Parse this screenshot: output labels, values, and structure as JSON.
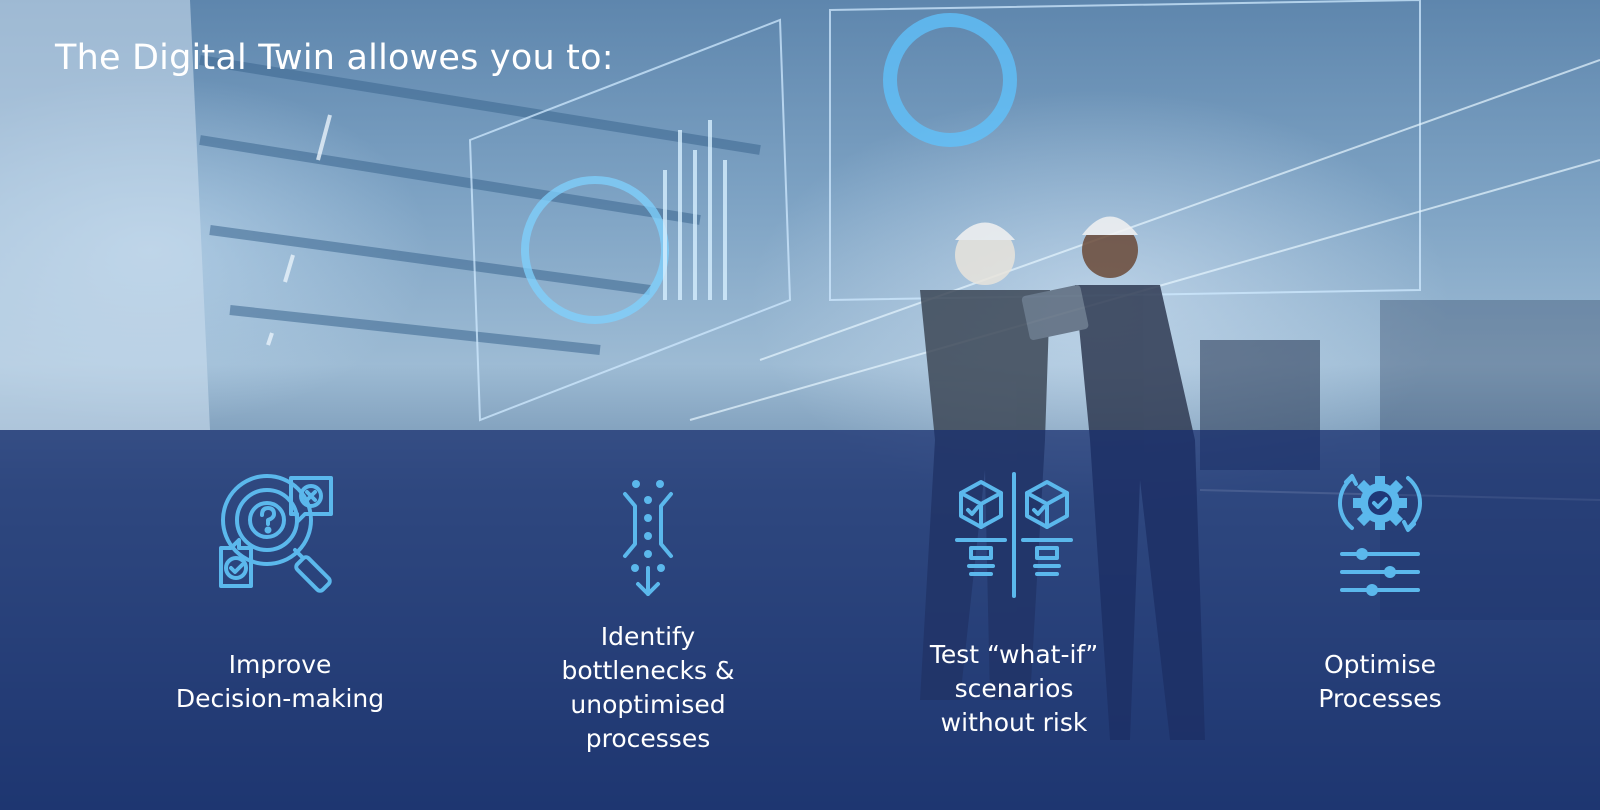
{
  "title": "The Digital Twin allowes you to:",
  "accent_color": "#5bb8ec",
  "features": [
    {
      "icon": "magnifier-question-icon",
      "label_lines": [
        "Improve",
        "Decision-making"
      ]
    },
    {
      "icon": "bottleneck-icon",
      "label_lines": [
        "Identify",
        "bottlenecks &",
        "unoptimised",
        "processes"
      ]
    },
    {
      "icon": "compare-boxes-icon",
      "label_lines": [
        "Test “what-if”",
        "scenarios",
        "without risk"
      ]
    },
    {
      "icon": "gear-sliders-icon",
      "label_lines": [
        "Optimise",
        "Processes"
      ]
    }
  ]
}
